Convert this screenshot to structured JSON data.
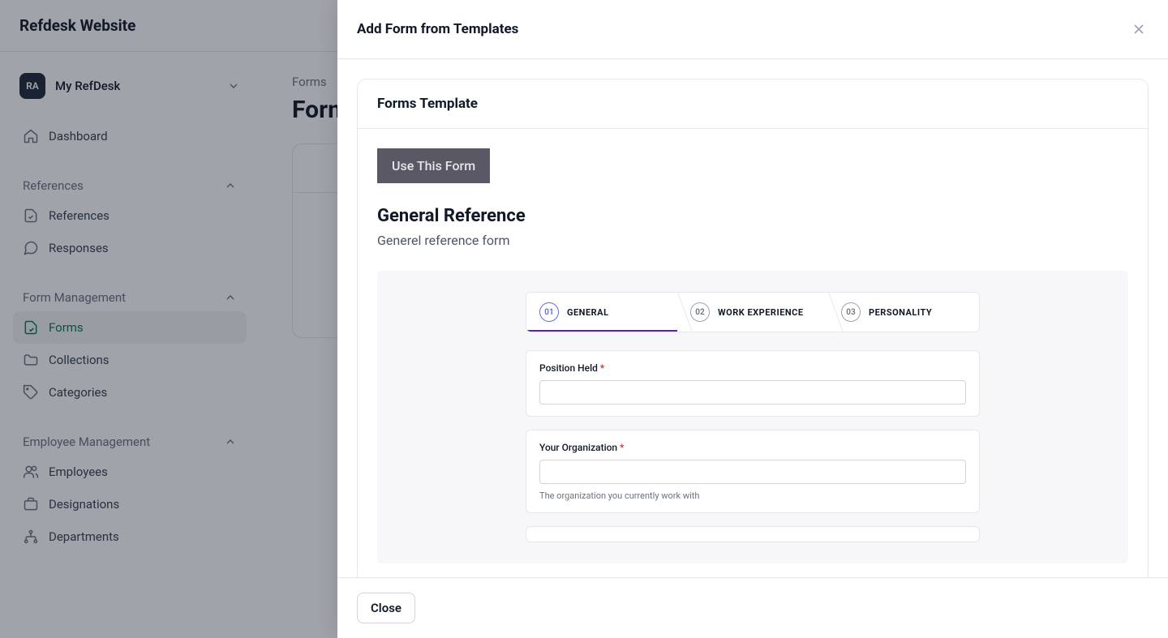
{
  "app_title": "Refdesk Website",
  "workspace": {
    "badge": "RA",
    "name": "My RefDesk"
  },
  "nav": {
    "dashboard": "Dashboard",
    "sections": [
      {
        "label": "References",
        "items": [
          "References",
          "Responses"
        ]
      },
      {
        "label": "Form Management",
        "items": [
          "Forms",
          "Collections",
          "Categories"
        ]
      },
      {
        "label": "Employee Management",
        "items": [
          "Employees",
          "Designations",
          "Departments"
        ]
      }
    ]
  },
  "breadcrumb": {
    "root": "Forms"
  },
  "page_title_partial": "Form",
  "drawer": {
    "title": "Add Form from Templates",
    "close_label": "Close",
    "card_title": "Forms Template",
    "use_button": "Use This Form",
    "template": {
      "name": "General Reference",
      "description": "Generel reference form"
    },
    "preview": {
      "steps": [
        {
          "num": "01",
          "label": "GENERAL"
        },
        {
          "num": "02",
          "label": "WORK EXPERIENCE"
        },
        {
          "num": "03",
          "label": "PERSONALITY"
        }
      ],
      "fields": [
        {
          "label": "Position Held",
          "required": true,
          "hint": ""
        },
        {
          "label": "Your Organization",
          "required": true,
          "hint": "The organization you currently work with"
        }
      ]
    }
  }
}
